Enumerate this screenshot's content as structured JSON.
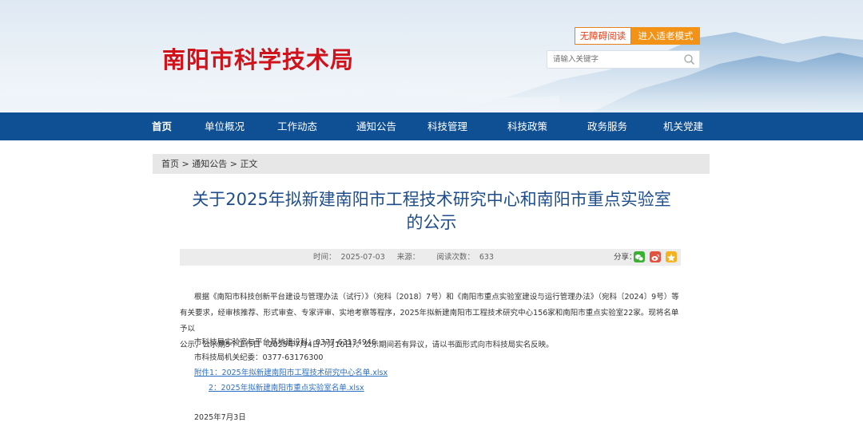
{
  "header": {
    "site_title": "南阳市科学技术局",
    "accessibility_label": "无障碍阅读",
    "elderly_mode_label": "进入适老模式",
    "search_placeholder": "请输入关键字"
  },
  "nav": {
    "items": [
      "首页",
      "单位概况",
      "工作动态",
      "通知公告",
      "科技管理",
      "科技政策",
      "政务服务",
      "机关党建"
    ],
    "active_index": 0
  },
  "breadcrumb": {
    "home": "首页",
    "sep1": " > ",
    "section": "通知公告",
    "sep2": " > ",
    "current": "正文"
  },
  "article": {
    "title_line1": "关于2025年拟新建南阳市工程技术研究中心和南阳市重点实验室",
    "title_line2": "的公示",
    "time_label": "时间：",
    "time_value": "2025-07-03",
    "source_label": "来源：",
    "source_value": "",
    "views_label": "阅读次数：",
    "views_value": "633",
    "share_label": "分享："
  },
  "body": {
    "para1_line1": "根据《南阳市科技创新平台建设与管理办法（试行）》（宛科〔2018〕7号）和《南阳市重点实验室建设与运行管理办法》（宛科〔2024〕9号）等",
    "para1_line2": "有关要求，经审核推荐、形式审查、专家评审、实地考察等程序，2025年拟新建南阳市工程技术研究中心156家和南阳市重点实验室22家。现将名单予以",
    "para1_line3": "公示，公示期5个工作日（2025年7月4日-7月10日）。公示期间若有异议，请以书面形式向市科技局实名反映。",
    "contact1": "市科技局实验室与平台基地建设科：0377-63134946",
    "contact2": "市科技局机关纪委：0377-63176300",
    "attachment1": "附件1：2025年拟新建南阳市工程技术研究中心名单.xlsx",
    "attachment2": "2：2025年拟新建南阳市重点实验室名单.xlsx",
    "date": "2025年7月3日"
  },
  "colors": {
    "brand_red": "#d0121b",
    "nav_blue": "#0f4f93",
    "title_blue": "#1f4e8c",
    "orange": "#f29216"
  }
}
